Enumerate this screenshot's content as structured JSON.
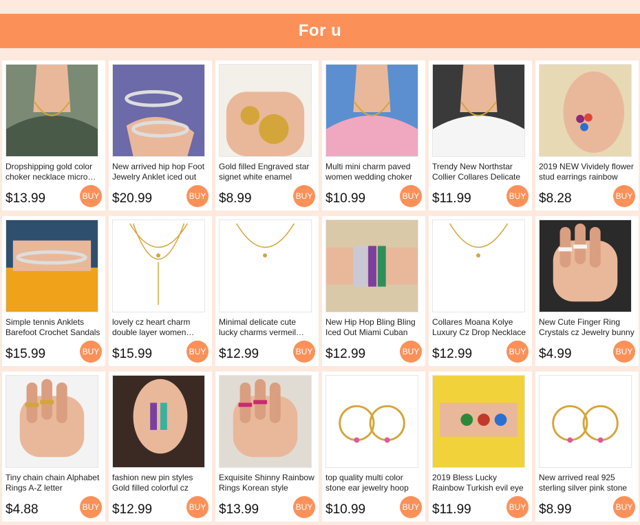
{
  "header": {
    "title": "For u"
  },
  "colors": {
    "accent": "#fb9159",
    "background": "#fde9de"
  },
  "products": [
    {
      "title": "Dropshipping gold color choker necklace micro pave",
      "price": "$13.99",
      "buy_label": "BUY",
      "image_icon": "necklace-on-neck-photo"
    },
    {
      "title": "New arrived hip hop Foot Jewelry Anklet iced out",
      "price": "$20.99",
      "buy_label": "BUY",
      "image_icon": "anklet-on-foot-photo"
    },
    {
      "title": "Gold filled Engraved star signet white enamel",
      "price": "$8.99",
      "buy_label": "BUY",
      "image_icon": "pendant-in-hand-photo"
    },
    {
      "title": "Multi mini charm paved women wedding choker",
      "price": "$10.99",
      "buy_label": "BUY",
      "image_icon": "choker-on-neck-photo"
    },
    {
      "title": "Trendy New Northstar Collier Collares Delicate",
      "price": "$11.99",
      "buy_label": "BUY",
      "image_icon": "layered-necklace-photo"
    },
    {
      "title": "2019 NEW Vividely flower stud earrings rainbow",
      "price": "$8.28",
      "buy_label": "BUY",
      "image_icon": "flower-earrings-photo"
    },
    {
      "title": "Simple tennis Anklets Barefoot Crochet Sandals",
      "price": "$15.99",
      "buy_label": "BUY",
      "image_icon": "tennis-anklet-photo"
    },
    {
      "title": "lovely cz heart charm double layer women necklace",
      "price": "$15.99",
      "buy_label": "BUY",
      "image_icon": "double-layer-necklace-photo"
    },
    {
      "title": "Minimal delicate cute lucky charms vermeil chain",
      "price": "$12.99",
      "buy_label": "BUY",
      "image_icon": "charm-necklace-photo"
    },
    {
      "title": "New Hip Hop Bling Bling Iced Out Miami Cuban",
      "price": "$12.99",
      "buy_label": "BUY",
      "image_icon": "cuban-bracelets-photo"
    },
    {
      "title": "Collares Moana Kolye Luxury Cz Drop Necklace",
      "price": "$12.99",
      "buy_label": "BUY",
      "image_icon": "drop-necklace-photo"
    },
    {
      "title": "New Cute Finger Ring Crystals cz Jewelry bunny",
      "price": "$4.99",
      "buy_label": "BUY",
      "image_icon": "bunny-ring-photo"
    },
    {
      "title": "Tiny chain chain Alphabet Rings A-Z letter",
      "price": "$4.88",
      "buy_label": "BUY",
      "image_icon": "alphabet-rings-photo"
    },
    {
      "title": "fashion new pin styles Gold filled colorful cz",
      "price": "$12.99",
      "buy_label": "BUY",
      "image_icon": "pin-earrings-photo"
    },
    {
      "title": "Exquisite Shinny Rainbow Rings Korean style",
      "price": "$13.99",
      "buy_label": "BUY",
      "image_icon": "rainbow-rings-photo"
    },
    {
      "title": "top quality multi color stone ear jewelry hoop",
      "price": "$10.99",
      "buy_label": "BUY",
      "image_icon": "hoop-earrings-photo"
    },
    {
      "title": "2019 Bless Lucky Rainbow Turkish evil eye",
      "price": "$11.99",
      "buy_label": "BUY",
      "image_icon": "evil-eye-bracelet-photo"
    },
    {
      "title": "New arrived real 925 sterling silver pink stone",
      "price": "$8.99",
      "buy_label": "BUY",
      "image_icon": "huggie-earrings-photo"
    }
  ]
}
